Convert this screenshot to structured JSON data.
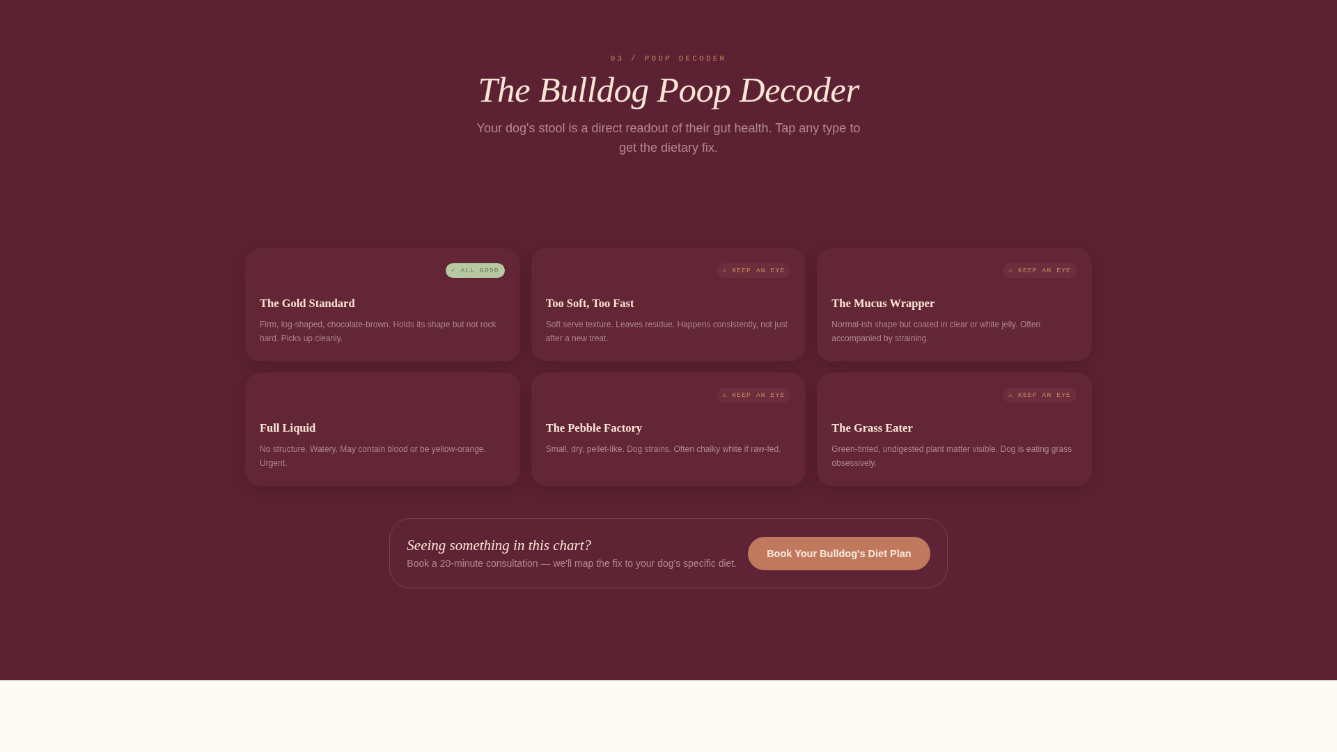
{
  "header": {
    "eyebrow": "03 / POOP DECODER",
    "title": "The Bulldog Poop Decoder",
    "subtitle": "Your dog's stool is a direct readout of their gut health. Tap any type to get the dietary fix."
  },
  "cards": [
    {
      "title": "The Gold Standard",
      "description": "Firm, log-shaped, chocolate-brown. Holds its shape but not rock hard. Picks up cleanly.",
      "badge": {
        "kind": "good",
        "label": "✓ ALL GOOD"
      }
    },
    {
      "title": "Too Soft, Too Fast",
      "description": "Soft serve texture. Leaves residue. Happens consistently, not just after a new treat.",
      "badge": {
        "kind": "watch",
        "label": "⚠ KEEP AN EYE"
      }
    },
    {
      "title": "The Mucus Wrapper",
      "description": "Normal-ish shape but coated in clear or white jelly. Often accompanied by straining.",
      "badge": {
        "kind": "watch",
        "label": "⚠ KEEP AN EYE"
      }
    },
    {
      "title": "Full Liquid",
      "description": "No structure. Watery. May contain blood or be yellow-orange. Urgent."
    },
    {
      "title": "The Pebble Factory",
      "description": "Small, dry, pellet-like. Dog strains. Often chalky white if raw-fed.",
      "badge": {
        "kind": "watch",
        "label": "⚠ KEEP AN EYE"
      }
    },
    {
      "title": "The Grass Eater",
      "description": "Green-tinted, undigested plant matter visible. Dog is eating grass obsessively.",
      "badge": {
        "kind": "watch",
        "label": "⚠ KEEP AN EYE"
      }
    }
  ],
  "cta": {
    "heading": "Seeing something in this chart?",
    "text": "Book a 20-minute consultation — we'll map the fix to your dog's specific diet.",
    "button": "Book Your Bulldog's Diet Plan"
  }
}
